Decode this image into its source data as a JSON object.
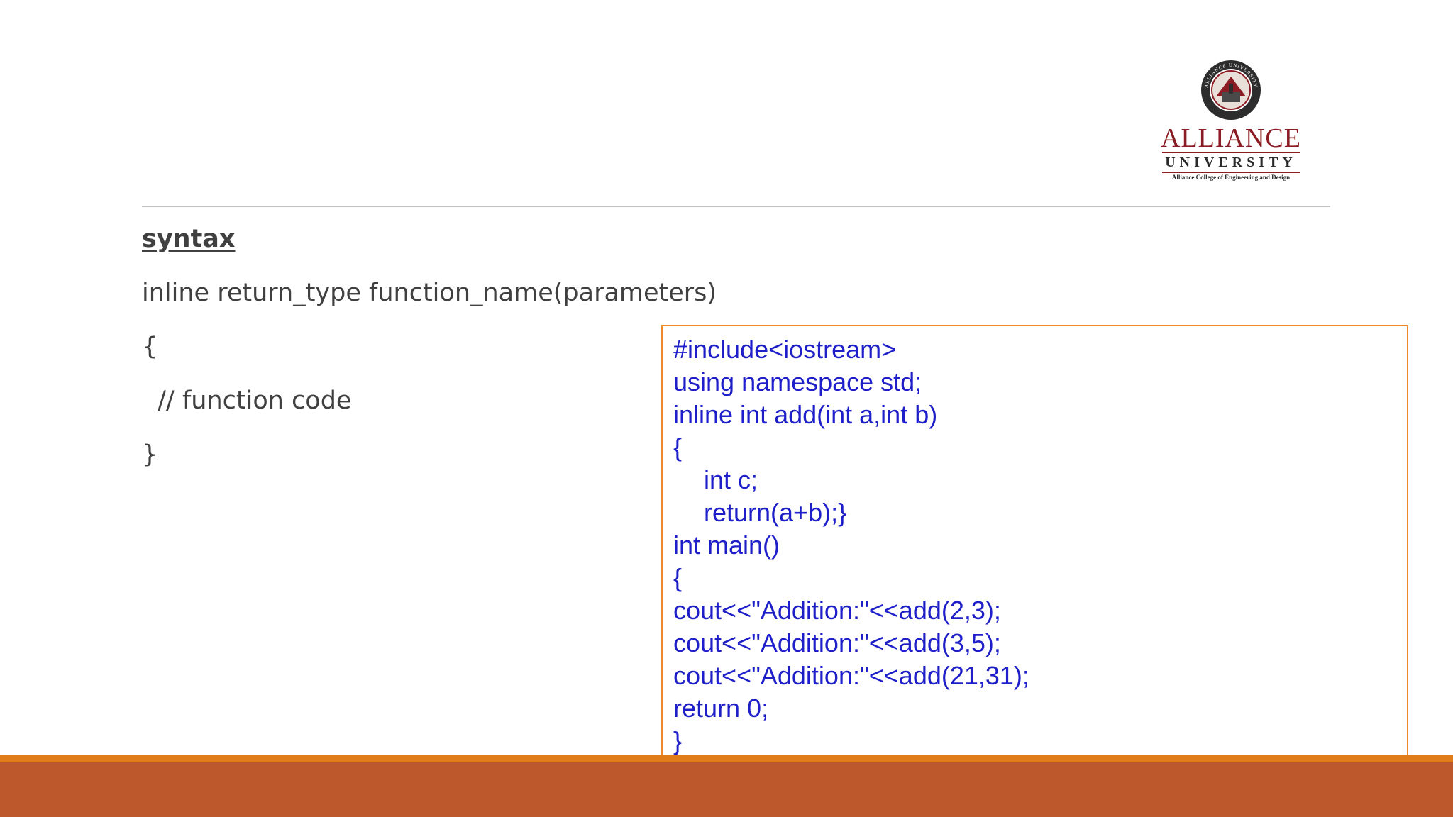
{
  "logo": {
    "seal_text": "ALLIANCE UNIVERSITY",
    "name": "ALLIANCE",
    "subtitle": "UNIVERSITY",
    "tagline": "Alliance College of Engineering and Design",
    "brand_color": "#8b1c24"
  },
  "syntax": {
    "heading": "syntax",
    "lines": [
      "inline return_type function_name(parameters)",
      "{",
      "  // function code",
      "}"
    ]
  },
  "code": {
    "text_color": "#1f1fc9",
    "border_color": "#ee8a2a",
    "lines": [
      "#include<iostream>",
      "using namespace std;",
      "inline int add(int a,int b)",
      "{",
      "int c;",
      "return(a+b);}",
      "int main()",
      "{",
      "cout<<\"Addition:\"<<add(2,3);",
      "cout<<\"Addition:\"<<add(3,5);",
      "cout<<\"Addition:\"<<add(21,31);",
      "return 0;",
      "}"
    ]
  },
  "colors": {
    "footer": "#bc582b",
    "footer_accent": "#e17c1b",
    "divider": "#c0c0c0",
    "body_text": "#404040"
  }
}
